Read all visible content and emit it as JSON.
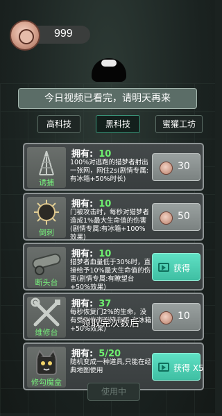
{
  "currency": {
    "amount": "999",
    "icon": "coin-face-icon"
  },
  "toast": "今日视频已看完，请明天再来",
  "tabs": [
    {
      "label": "高科技",
      "active": false
    },
    {
      "label": "黑科技",
      "active": true
    },
    {
      "label": "蜜獾工坊",
      "active": false
    }
  ],
  "items": [
    {
      "name": "诱捕",
      "icon": "trap-icon",
      "own_label": "拥有:",
      "own_value": "10",
      "desc": "100%对逃跑的猎梦者射出一张网，网住2s(剧情专属:有冰箱+50%时长)",
      "button": {
        "type": "coin",
        "price": "30"
      }
    },
    {
      "name": "倒刺",
      "icon": "spike-ball-icon",
      "own_label": "拥有:",
      "own_value": "10",
      "desc": "门被攻击时，每秒对猎梦者造成1%最大生命值的伤害(剧情专属:有冰箱+100%效果)",
      "button": {
        "type": "coin",
        "price": "50"
      }
    },
    {
      "name": "断头台",
      "icon": "cannon-icon",
      "own_label": "拥有:",
      "own_value": "10",
      "desc": "猎梦者血量低于30%时，直接给予10%最大生命值的伤害(剧情专属:有瞭望台+50%效果)",
      "button": {
        "type": "video",
        "label": "获得"
      }
    },
    {
      "name": "维修台",
      "icon": "tools-icon",
      "own_label": "拥有:",
      "own_value": "37",
      "desc": "每秒恢复门2%的生命，没有受到伤害剧情专属:有冰箱+50%效果)",
      "button": {
        "type": "coin",
        "price": "10"
      }
    },
    {
      "name": "修勾魔盒",
      "icon": "dog-box-icon",
      "own_label": "拥有:",
      "own_value": "5/20",
      "desc": "随机变成一种道具,只能在经典地图使用",
      "button": {
        "type": "video",
        "label": "获得 X5"
      }
    }
  ],
  "overlay_message": "领取完次数后",
  "bottom_button": "使用中",
  "colors": {
    "accent_green": "#6ef06f",
    "video_button": "#4fd0b4",
    "tab_active_border": "#3b9579"
  }
}
